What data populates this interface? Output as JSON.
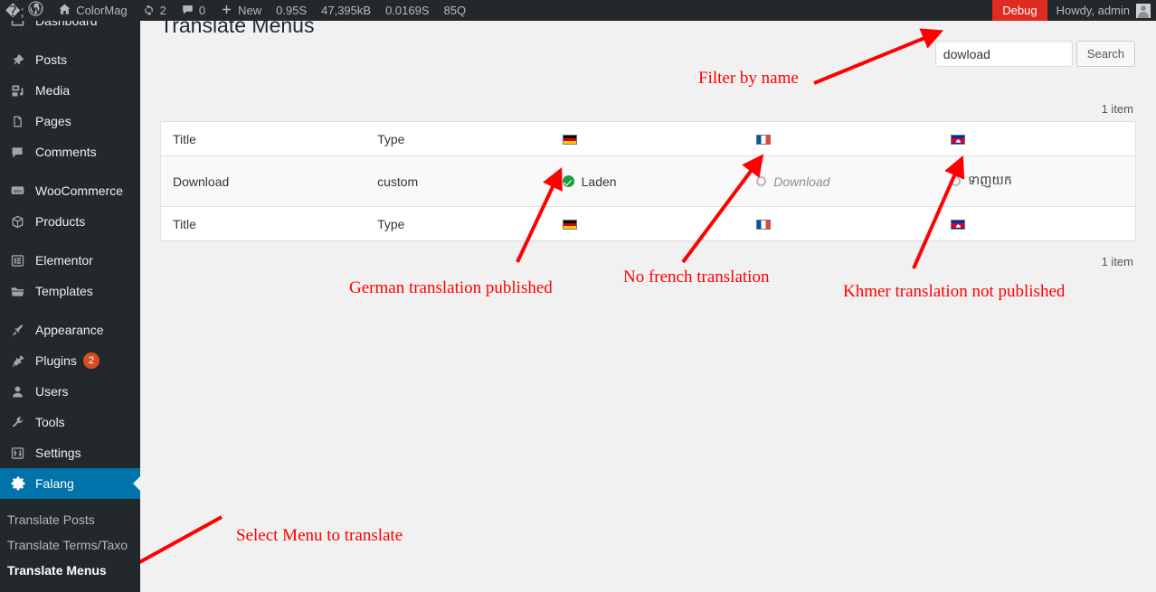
{
  "adminbar": {
    "wp_logo": "wordpress-logo-icon",
    "site_name": "ColorMag",
    "updates_icon": "updates-icon",
    "updates_count": "2",
    "comments_icon": "comments-icon",
    "comments_count": "0",
    "new_icon": "plus-icon",
    "new_label": "New",
    "debug_time": "0.95S",
    "debug_memory": "47,395kB",
    "debug_query_time": "0.0169S",
    "debug_queries": "85Q",
    "debug_label": "Debug",
    "debug_color": "#e02b20",
    "howdy": "Howdy, admin",
    "avatar": "user-avatar"
  },
  "sidebar": {
    "accent_color": "#0073aa",
    "items": [
      {
        "label": "Dashboard",
        "icon": "dashboard-icon",
        "name": "dashboard"
      },
      {
        "label": "Posts",
        "icon": "pin-icon",
        "name": "posts"
      },
      {
        "label": "Media",
        "icon": "media-icon",
        "name": "media"
      },
      {
        "label": "Pages",
        "icon": "pages-icon",
        "name": "pages"
      },
      {
        "label": "Comments",
        "icon": "comment-bubble-icon",
        "name": "comments"
      },
      {
        "label": "WooCommerce",
        "icon": "woocommerce-icon",
        "name": "woocommerce"
      },
      {
        "label": "Products",
        "icon": "box-icon",
        "name": "products"
      },
      {
        "label": "Elementor",
        "icon": "elementor-icon",
        "name": "elementor"
      },
      {
        "label": "Templates",
        "icon": "folder-icon",
        "name": "templates"
      },
      {
        "label": "Appearance",
        "icon": "paintbrush-icon",
        "name": "appearance"
      },
      {
        "label": "Plugins",
        "icon": "plug-icon",
        "name": "plugins",
        "badge": "2"
      },
      {
        "label": "Users",
        "icon": "user-icon",
        "name": "users"
      },
      {
        "label": "Tools",
        "icon": "wrench-icon",
        "name": "tools"
      },
      {
        "label": "Settings",
        "icon": "sliders-icon",
        "name": "settings"
      },
      {
        "label": "Falang",
        "icon": "gear-icon",
        "name": "falang",
        "active": true
      }
    ],
    "submenu": [
      {
        "label": "Translate Posts",
        "name": "translate-posts"
      },
      {
        "label": "Translate Terms/Taxo",
        "name": "translate-terms-taxo"
      },
      {
        "label": "Translate Menus",
        "name": "translate-menus",
        "current": true
      }
    ]
  },
  "page": {
    "title": "Translate Menus"
  },
  "search": {
    "value": "dowload",
    "placeholder": "",
    "button_label": "Search"
  },
  "counts": {
    "top": "1 item",
    "bottom": "1 item"
  },
  "table": {
    "headers": {
      "title": "Title",
      "type": "Type",
      "lang_de": "german-flag-icon",
      "lang_fr": "french-flag-icon",
      "lang_kh": "cambodian-flag-icon"
    },
    "rows": [
      {
        "title": "Download",
        "type": "custom",
        "de": {
          "status": "published",
          "text": "Laden",
          "status_icon": "green-check-icon"
        },
        "fr": {
          "status": "untranslated",
          "text": "Download",
          "status_icon": "gray-circle-icon"
        },
        "kh": {
          "status": "unpublished",
          "text": "ទាញយក",
          "status_icon": "gray-circle-icon"
        }
      }
    ]
  },
  "annotations": {
    "color": "#ff0000",
    "filter_by_name": "Filter by name",
    "german_published": "German translation published",
    "no_french": "No french translation",
    "khmer_not_published": "Khmer translation not published",
    "select_menu": "Select Menu to translate"
  }
}
